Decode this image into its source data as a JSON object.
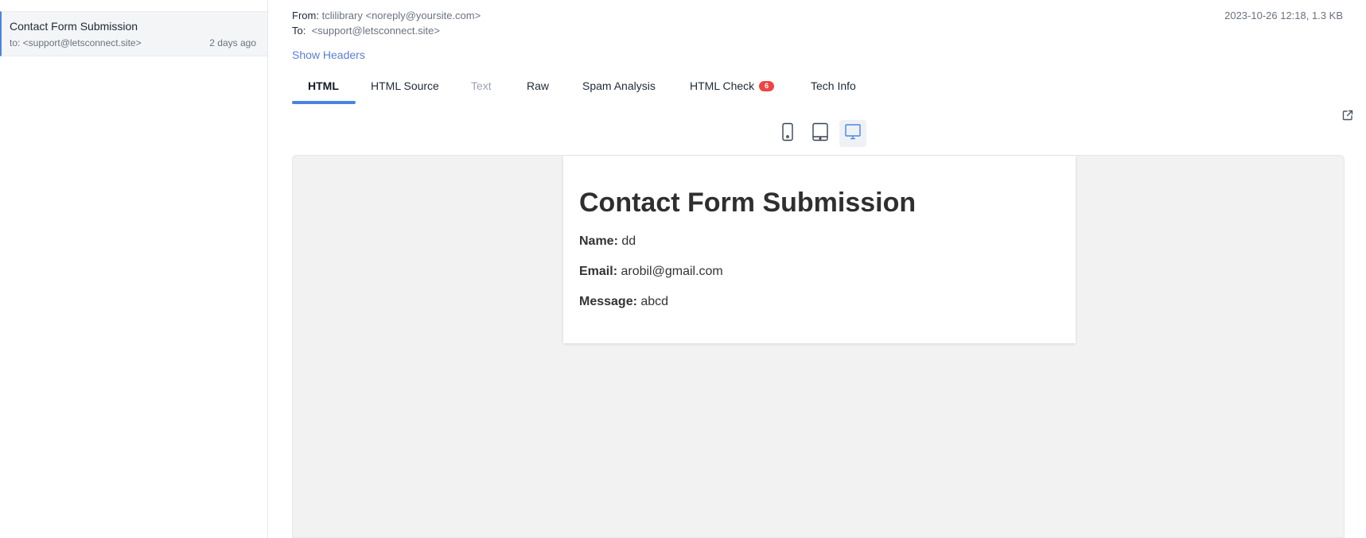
{
  "sidebar": {
    "message": {
      "subject": "Contact Form Submission",
      "to": "to: <support@letsconnect.site>",
      "time": "2 days ago"
    }
  },
  "header": {
    "from_label": "From:",
    "from_value": "tclilibrary <noreply@yoursite.com>",
    "to_label": "To:",
    "to_value": "<support@letsconnect.site>",
    "meta": "2023-10-26 12:18, 1.3 KB",
    "show_headers": "Show Headers"
  },
  "tabs": [
    {
      "label": "HTML",
      "state": "active"
    },
    {
      "label": "HTML Source",
      "state": "normal"
    },
    {
      "label": "Text",
      "state": "disabled"
    },
    {
      "label": "Raw",
      "state": "normal"
    },
    {
      "label": "Spam Analysis",
      "state": "normal"
    },
    {
      "label": "HTML Check",
      "state": "normal",
      "badge": "6"
    },
    {
      "label": "Tech Info",
      "state": "normal"
    }
  ],
  "toolbar": {
    "devices": [
      {
        "icon": "phone-icon",
        "active": false
      },
      {
        "icon": "tablet-icon",
        "active": false
      },
      {
        "icon": "desktop-icon",
        "active": true
      }
    ],
    "external_icon": "external-link-icon"
  },
  "email": {
    "title": "Contact Form Submission",
    "fields": [
      {
        "label": "Name:",
        "value": "dd"
      },
      {
        "label": "Email:",
        "value": "arobil@gmail.com"
      },
      {
        "label": "Message:",
        "value": "abcd"
      }
    ]
  },
  "colors": {
    "accent": "#4a84e0",
    "link": "#5a7fd6",
    "badge": "#ef4444"
  }
}
